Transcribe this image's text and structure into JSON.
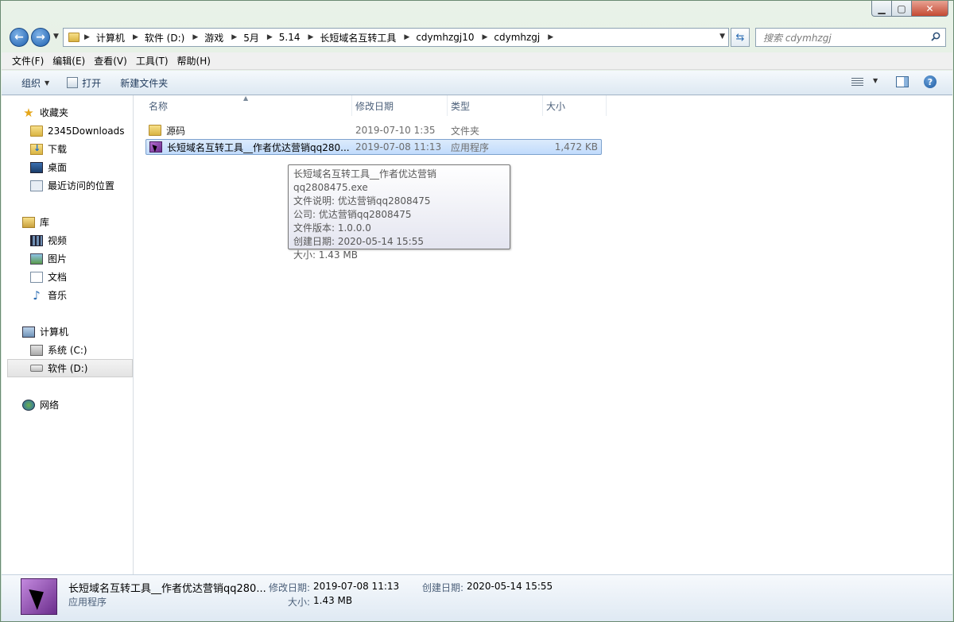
{
  "window": {
    "min_label": "▁",
    "max_label": "▢",
    "close_label": "✕"
  },
  "address": {
    "crumbs": [
      "计算机",
      "软件 (D:)",
      "游戏",
      "5月",
      "5.14",
      "长短域名互转工具",
      "cdymhzgj10",
      "cdymhzgj"
    ],
    "search_placeholder": "搜索 cdymhzgj"
  },
  "menu": [
    "文件(F)",
    "编辑(E)",
    "查看(V)",
    "工具(T)",
    "帮助(H)"
  ],
  "toolbar": {
    "organize_label": "组织",
    "open_label": "打开",
    "new_folder_label": "新建文件夹"
  },
  "nav": {
    "favorites_label": "收藏夹",
    "favorites": [
      "2345Downloads",
      "下载",
      "桌面",
      "最近访问的位置"
    ],
    "libraries_label": "库",
    "libraries": [
      "视频",
      "图片",
      "文档",
      "音乐"
    ],
    "computer_label": "计算机",
    "drives": [
      "系统 (C:)",
      "软件 (D:)"
    ],
    "network_label": "网络"
  },
  "columns": {
    "name": "名称",
    "modified": "修改日期",
    "type": "类型",
    "size": "大小"
  },
  "files": [
    {
      "name": "源码",
      "modified": "2019-07-10 1:35",
      "type": "文件夹",
      "size": "",
      "icon": "folder-icon"
    },
    {
      "name": "长短域名互转工具__作者优达营销qq280...",
      "modified": "2019-07-08 11:13",
      "type": "应用程序",
      "size": "1,472 KB",
      "icon": "exe-icon"
    }
  ],
  "tooltip": [
    "长短域名互转工具__作者优达营销qq2808475.exe",
    "文件说明: 优达营销qq2808475",
    "公司: 优达营销qq2808475",
    "文件版本: 1.0.0.0",
    "创建日期: 2020-05-14 15:55",
    "大小: 1.43 MB"
  ],
  "details": {
    "title": "长短域名互转工具__作者优达营销qq280...",
    "type": "应用程序",
    "modified_label": "修改日期:",
    "modified_value": "2019-07-08 11:13",
    "created_label": "创建日期:",
    "created_value": "2020-05-14 15:55",
    "size_label": "大小:",
    "size_value": "1.43 MB"
  },
  "colors": {
    "selection": "#c1dbfc",
    "title_gradient": "#cfe3d6",
    "link_text": "#1e395b"
  }
}
